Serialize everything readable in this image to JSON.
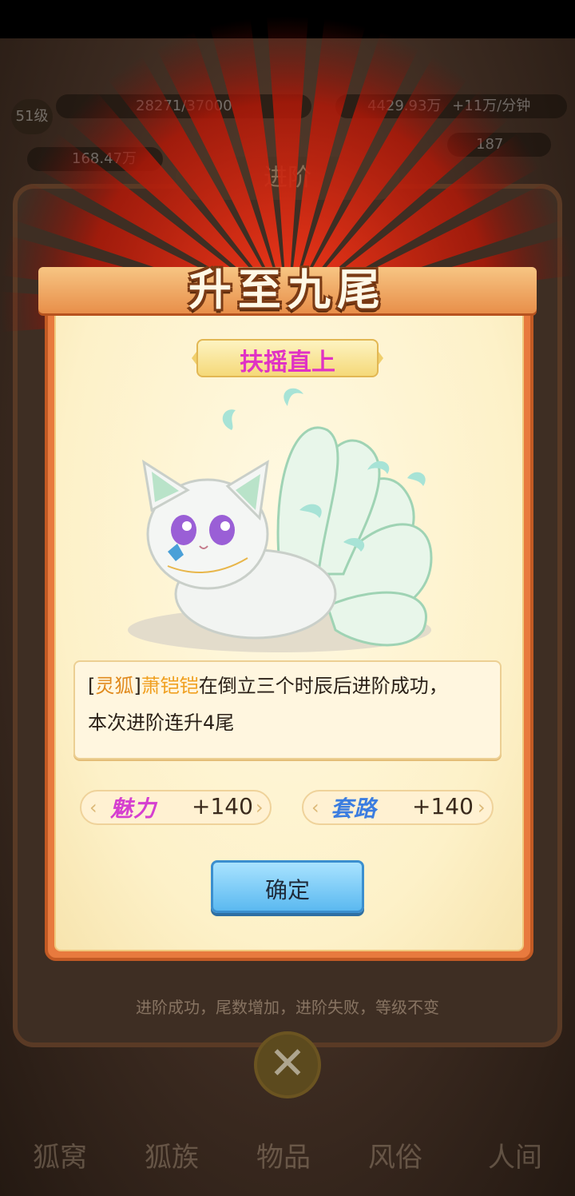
{
  "background": {
    "level": "51级",
    "exp": "28271/37000",
    "money": "4429.93万",
    "money_extra": "+11万/分钟",
    "stat_left": "168.47万",
    "stat_right": "187",
    "panel_title": "进阶",
    "hint": "进阶成功，尾数增加，进阶失败，等级不变",
    "tabs": [
      "狐窝",
      "狐族",
      "物品",
      "风俗",
      "人间"
    ]
  },
  "dialog": {
    "title": "升至九尾",
    "subtitle": "扶摇直上",
    "message": {
      "line1_bracket_open": "[",
      "line1_tag": "灵狐",
      "line1_bracket_close": "]",
      "line1_name": "萧铠铠",
      "line1_rest": "在倒立三个时辰后进阶成功，",
      "line2": "本次进阶连升4尾"
    },
    "stats": [
      {
        "label": "魅力",
        "value": "+140",
        "color": "#d53fd0"
      },
      {
        "label": "套路",
        "value": "+140",
        "color": "#3b7de0"
      }
    ],
    "confirm_label": "确定"
  },
  "colors": {
    "accent_orange": "#e87a3e",
    "subtitle_magenta": "#e032c4",
    "button_blue": "#5bb9f0"
  }
}
